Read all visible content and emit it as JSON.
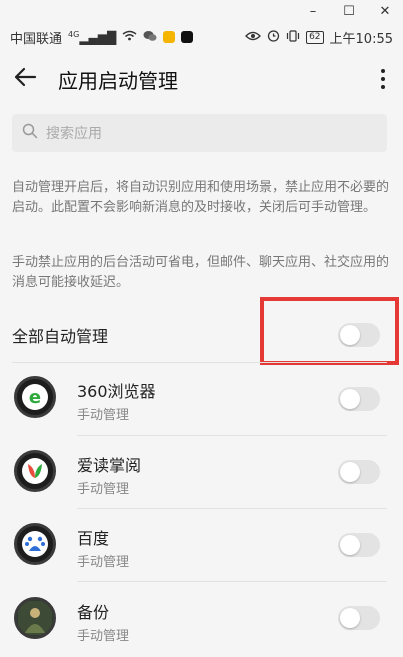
{
  "window_controls": [
    "–",
    "☐",
    "✕"
  ],
  "status_bar": {
    "carrier": "中国联通",
    "network": "4G",
    "battery": "62",
    "time": "上午10:55"
  },
  "app_bar": {
    "title": "应用启动管理"
  },
  "search": {
    "placeholder": "搜索应用"
  },
  "description": {
    "para1": "自动管理开启后，将自动识别应用和使用场景，禁止应用不必要的启动。此配置不会影响新消息的及时接收，关闭后可手动管理。",
    "para2": "手动禁止应用的后台活动可省电，但邮件、聊天应用、社交应用的消息可能接收延迟。"
  },
  "master_toggle": {
    "label": "全部自动管理",
    "on": false
  },
  "apps": [
    {
      "name": "360浏览器",
      "mode": "手动管理",
      "on": false,
      "icon": "360-browser-icon"
    },
    {
      "name": "爱读掌阅",
      "mode": "手动管理",
      "on": false,
      "icon": "ireader-icon"
    },
    {
      "name": "百度",
      "mode": "手动管理",
      "on": false,
      "icon": "baidu-icon"
    },
    {
      "name": "备份",
      "mode": "手动管理",
      "on": false,
      "icon": "backup-icon"
    }
  ],
  "colors": {
    "highlight": "#e53935",
    "toggle_off": "#e3e3e3",
    "background": "#f5f5f5"
  }
}
